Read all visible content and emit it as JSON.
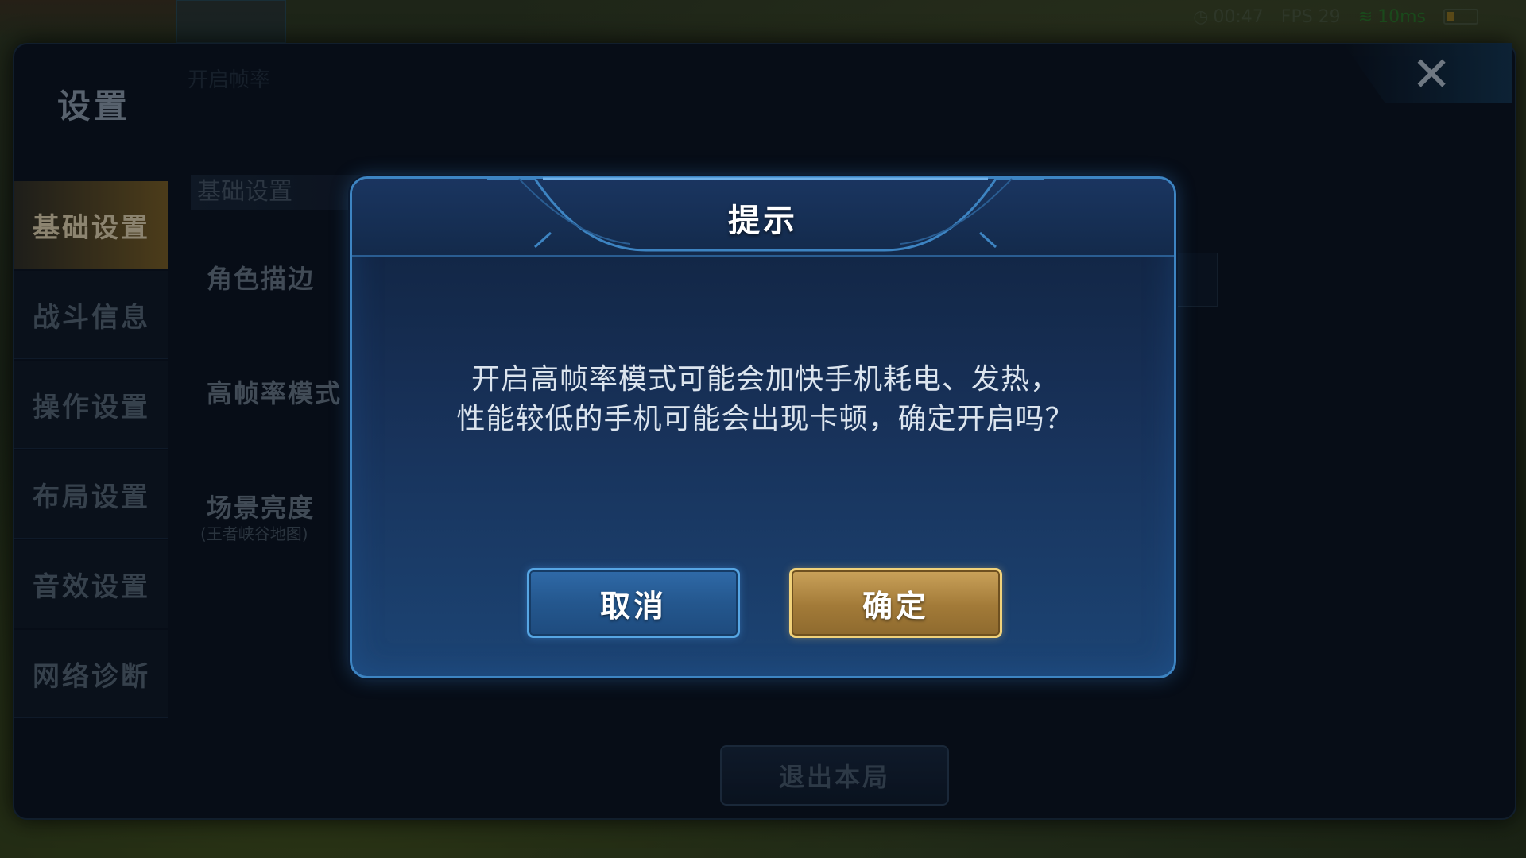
{
  "hud": {
    "timer": "00:47",
    "fps": "FPS 29",
    "ping": "10ms"
  },
  "settings": {
    "title": "设置",
    "tab_hint": "开启帧率",
    "sidebar": [
      {
        "label": "基础设置",
        "active": true
      },
      {
        "label": "战斗信息",
        "active": false
      },
      {
        "label": "操作设置",
        "active": false
      },
      {
        "label": "布局设置",
        "active": false
      },
      {
        "label": "音效设置",
        "active": false
      },
      {
        "label": "网络诊断",
        "active": false
      }
    ],
    "section_header": "基础设置",
    "rows": [
      {
        "label": "角色描边"
      },
      {
        "label": "高帧率模式"
      },
      {
        "label": "场景亮度",
        "sub": "(王者峡谷地图)"
      }
    ],
    "quit_label": "退出本局"
  },
  "dialog": {
    "title": "提示",
    "message_line1": "开启高帧率模式可能会加快手机耗电、发热，",
    "message_line2": "性能较低的手机可能会出现卡顿，确定开启吗？",
    "cancel_label": "取消",
    "confirm_label": "确定"
  },
  "colors": {
    "dialog_border": "#3d84c2",
    "confirm_gold": "#caa25a",
    "cancel_blue": "#2f6aa8",
    "active_tab": "#6a5424"
  }
}
